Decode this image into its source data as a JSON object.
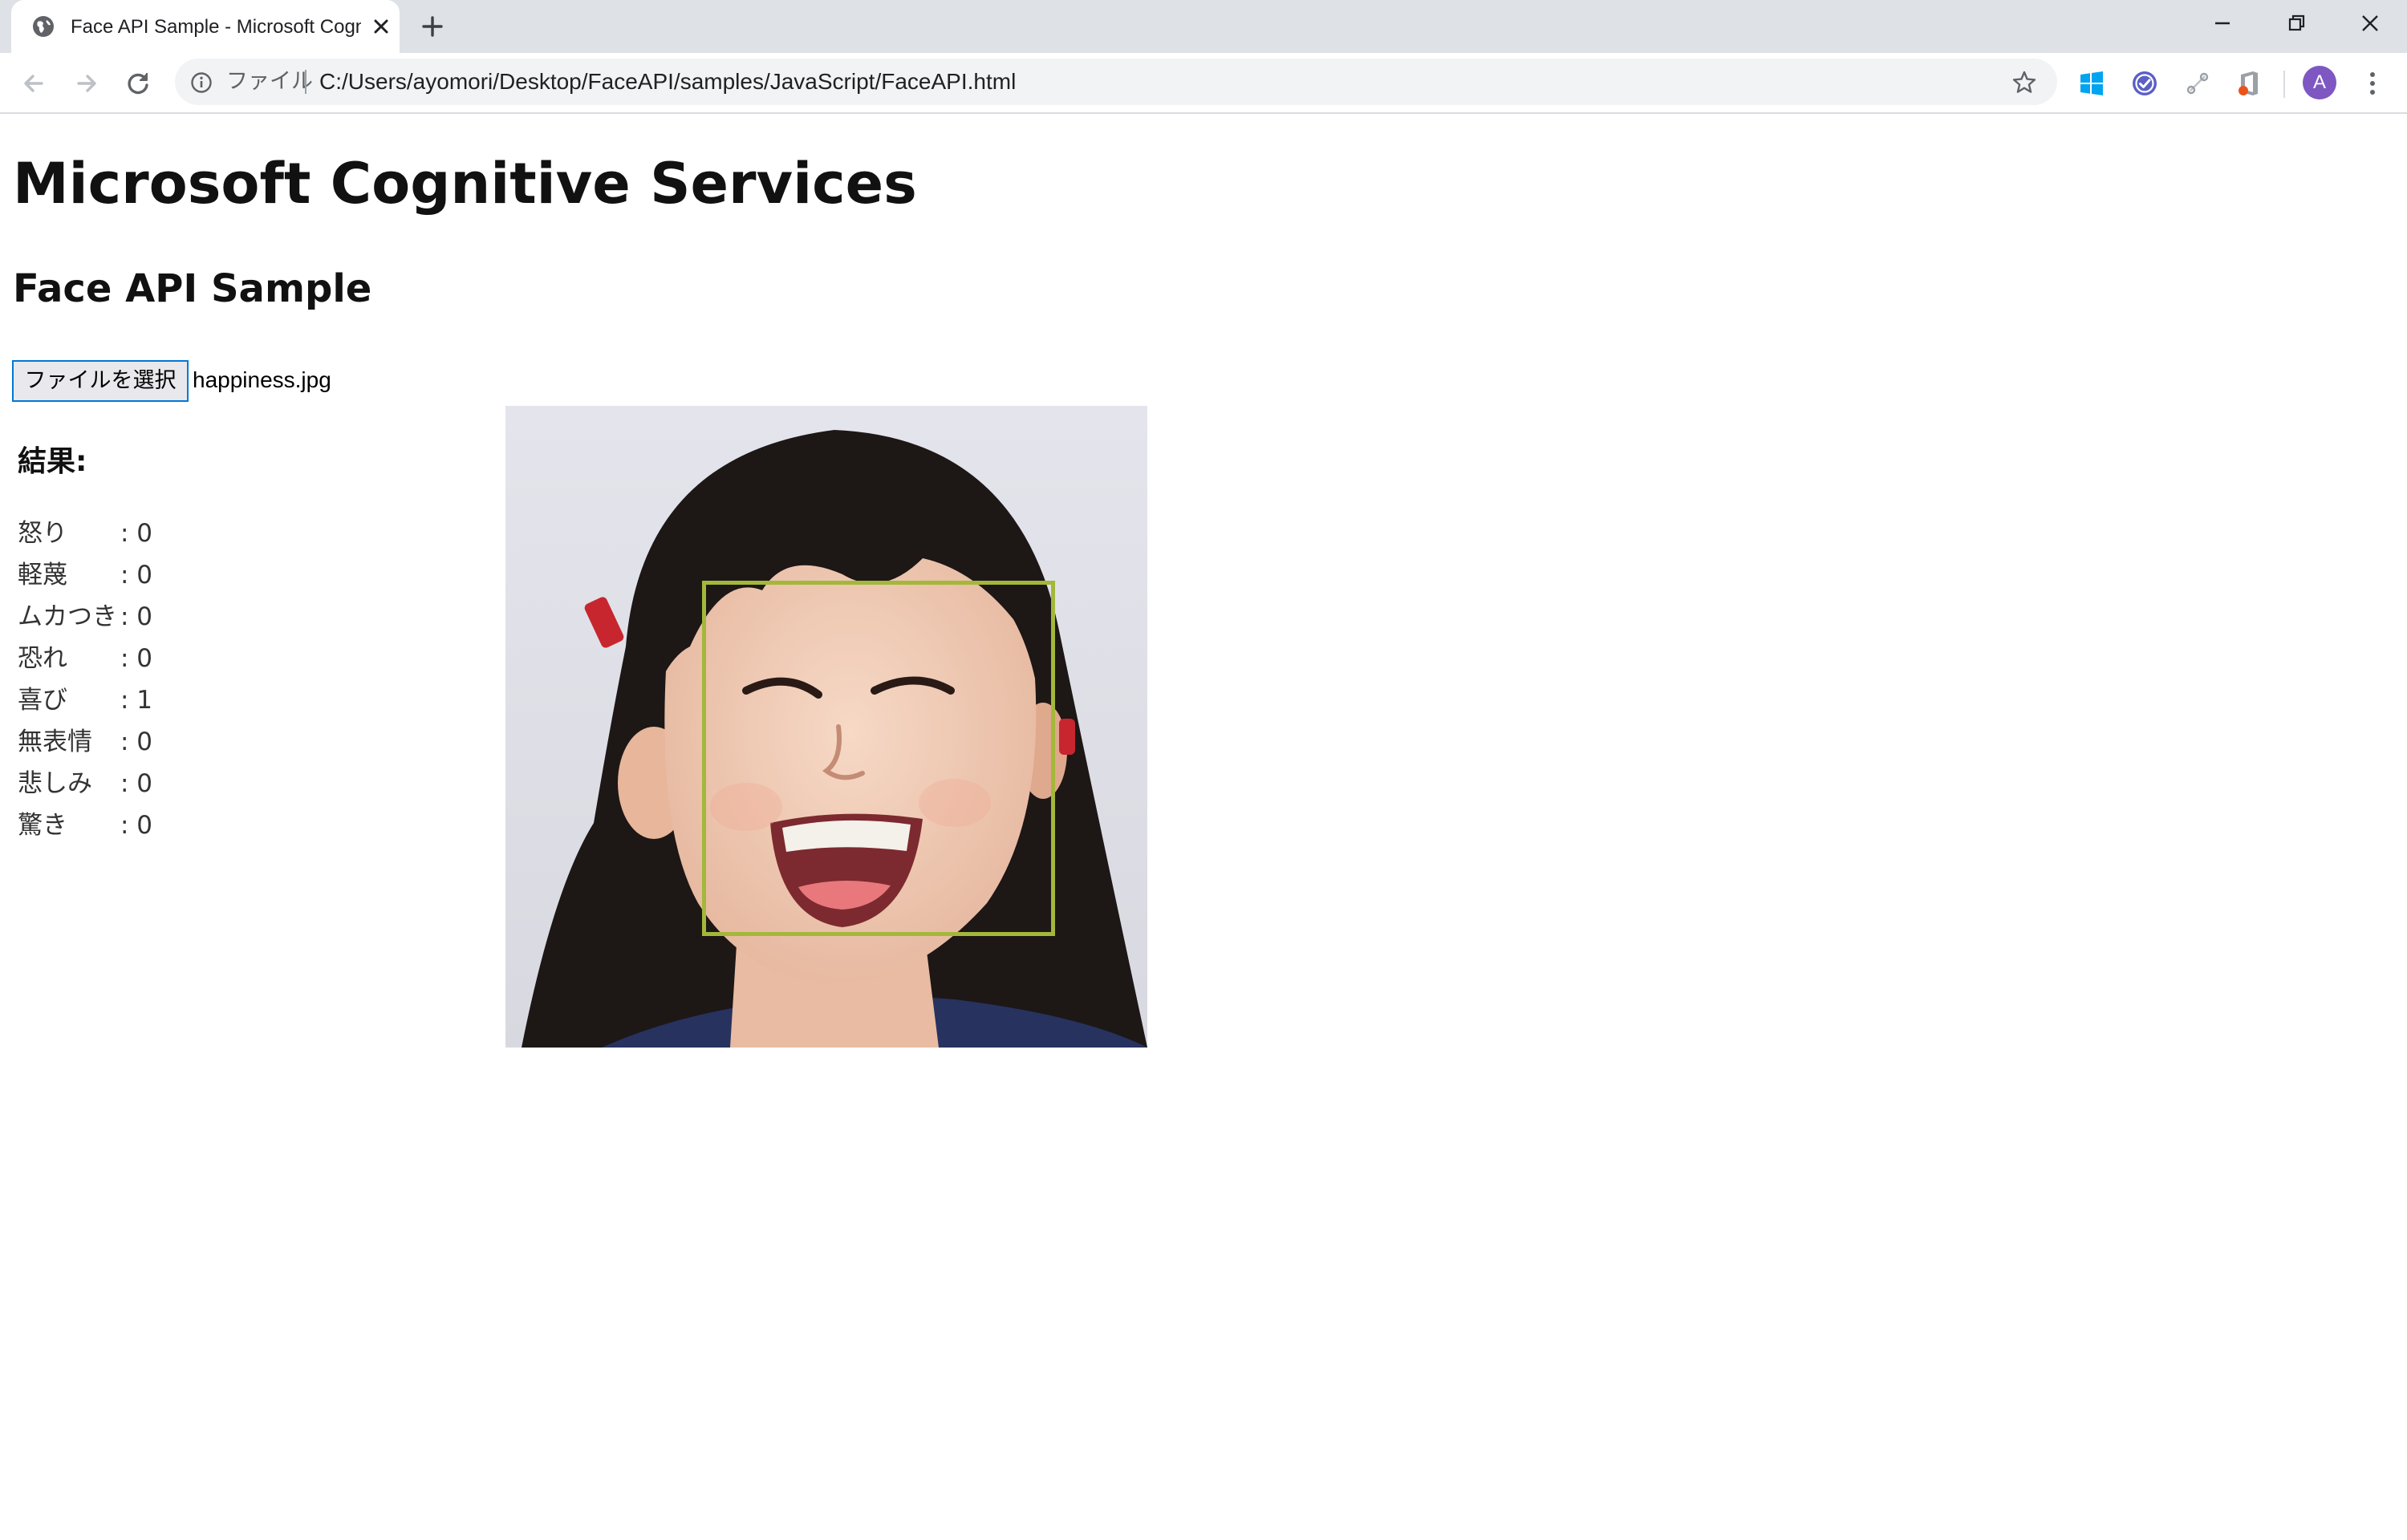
{
  "browser": {
    "tab_title": "Face API Sample - Microsoft Cognitive Services",
    "address_label": "ファイル",
    "url": "C:/Users/ayomori/Desktop/FaceAPI/samples/JavaScript/FaceAPI.html",
    "avatar_letter": "A",
    "accent_color": "#7e57c2"
  },
  "page": {
    "heading": "Microsoft Cognitive Services",
    "subheading": "Face API Sample",
    "file_button_label": "ファイルを選択",
    "file_name": "happiness.jpg",
    "results_title": "結果:",
    "emotions": [
      {
        "label": "怒り",
        "value": ": 0"
      },
      {
        "label": "軽蔑",
        "value": ": 0"
      },
      {
        "label": "ムカつき",
        "value": ": 0"
      },
      {
        "label": "恐れ",
        "value": ": 0"
      },
      {
        "label": "喜び",
        "value": ": 1"
      },
      {
        "label": "無表情",
        "value": ": 0"
      },
      {
        "label": "悲しみ",
        "value": ": 0"
      },
      {
        "label": "驚き",
        "value": ": 0"
      }
    ],
    "face_box_color": "#a3b83a"
  }
}
